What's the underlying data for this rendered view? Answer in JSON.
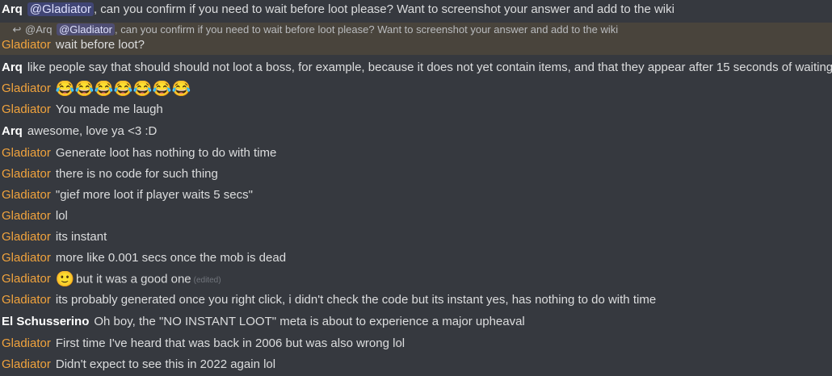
{
  "messages": [
    {
      "author": "Arq",
      "mention": "@Gladiator",
      "text": ", can you confirm if you need to wait before loot please? Want to screenshot your answer and add to the wiki"
    },
    {
      "reply_author": "@Arq",
      "reply_mention": "@Gladiator",
      "reply_text": ", can you confirm if you need to wait before loot please? Want to screenshot your answer and add to the wiki"
    },
    {
      "author": "Gladiator",
      "text": "wait before loot?"
    },
    {
      "author": "Arq",
      "text": "like people say that should should not loot a boss, for example, because it does not yet contain items, and that they appear after 15 seconds of waiting"
    },
    {
      "author": "Gladiator",
      "emojis": [
        "😂",
        "😂",
        "😂",
        "😂",
        "😂",
        "😂",
        "😂"
      ]
    },
    {
      "author": "Gladiator",
      "text": "You made me laugh"
    },
    {
      "author": "Arq",
      "text": "awesome, love ya <3 :D"
    },
    {
      "author": "Gladiator",
      "text": "Generate loot has nothing to do with time"
    },
    {
      "author": "Gladiator",
      "text": "there is no code for such thing"
    },
    {
      "author": "Gladiator",
      "text": "\"gief more loot if player waits 5 secs\""
    },
    {
      "author": "Gladiator",
      "text": "lol"
    },
    {
      "author": "Gladiator",
      "text": "its instant"
    },
    {
      "author": "Gladiator",
      "text": "more like 0.001 secs once the mob is dead"
    },
    {
      "author": "Gladiator",
      "emoji": "🙂",
      "text": "but it was a good one",
      "edited": "(edited)"
    },
    {
      "author": "Gladiator",
      "text": "its probably generated once you right click, i didn't check the code but its instant yes, has nothing to do with time"
    },
    {
      "author": "El Schusserino",
      "text": "Oh boy, the \"NO INSTANT LOOT\" meta is about to experience a major upheaval"
    },
    {
      "author": "Gladiator",
      "text": "First time I've heard that was back in 2006 but was also wrong lol"
    },
    {
      "author": "Gladiator",
      "text": "Didn't expect to see this in 2022 again lol"
    }
  ],
  "icons": {
    "reply": "reply-arrow-icon"
  },
  "colors": {
    "background": "#36393f",
    "gladiator": "#f1a33d",
    "white_author": "#ffffff",
    "text": "#dcddde",
    "reply_bg": "#49443c"
  }
}
